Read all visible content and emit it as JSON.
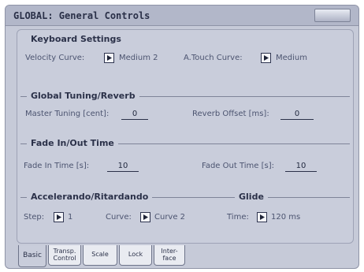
{
  "window": {
    "title": "GLOBAL: General Controls"
  },
  "keyboard_settings": {
    "title": "Keyboard Settings",
    "velocity_curve_label": "Velocity Curve:",
    "velocity_curve_value": "Medium 2",
    "atouch_curve_label": "A.Touch Curve:",
    "atouch_curve_value": "Medium"
  },
  "global_tuning": {
    "title": "Global Tuning/Reverb",
    "master_tuning_label": "Master Tuning [cent]:",
    "master_tuning_value": "0",
    "reverb_offset_label": "Reverb Offset [ms]:",
    "reverb_offset_value": "0"
  },
  "fade": {
    "title": "Fade In/Out Time",
    "fade_in_label": "Fade In Time [s]:",
    "fade_in_value": "10",
    "fade_out_label": "Fade Out Time [s]:",
    "fade_out_value": "10"
  },
  "accel": {
    "title": "Accelerando/Ritardando",
    "step_label": "Step:",
    "step_value": "1",
    "curve_label": "Curve:",
    "curve_value": "Curve 2"
  },
  "glide": {
    "title": "Glide",
    "time_label": "Time:",
    "time_value": "120 ms"
  },
  "tabs": [
    {
      "label": "Basic"
    },
    {
      "label": "Transp. Control"
    },
    {
      "label": "Scale"
    },
    {
      "label": "Lock"
    },
    {
      "label": "Inter- face"
    }
  ],
  "colors": {
    "panel": "#c9cddb",
    "text_dark": "#2b3149",
    "text_label": "#4c5470"
  }
}
